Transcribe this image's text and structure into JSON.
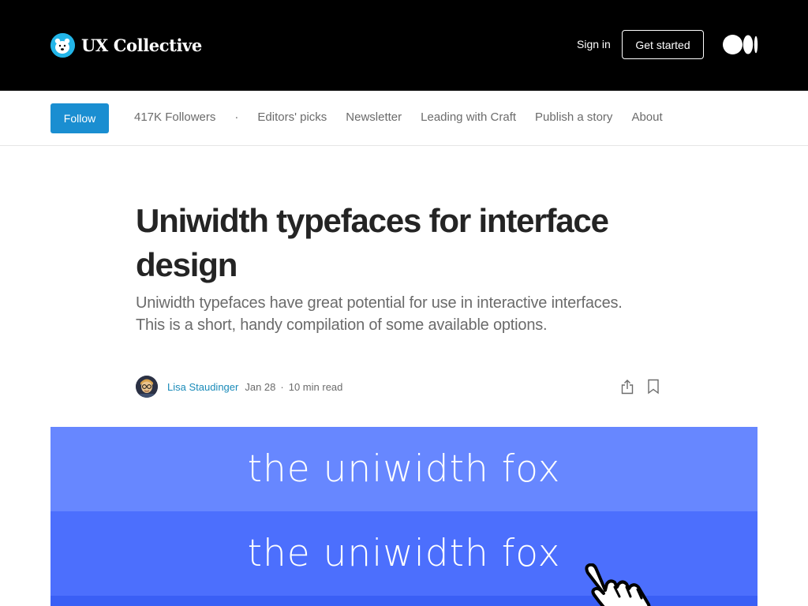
{
  "header": {
    "brand_name": "UX Collective",
    "sign_in": "Sign in",
    "get_started": "Get started",
    "medium_logo": "medium-logo-icon"
  },
  "pubnav": {
    "follow": "Follow",
    "followers": "417K Followers",
    "separator": "·",
    "links": [
      "Editors' picks",
      "Newsletter",
      "Leading with Craft",
      "Publish a story",
      "About"
    ]
  },
  "article": {
    "title": "Uniwidth typefaces for interface design",
    "subtitle": "Uniwidth typefaces have great potential for use in interactive interfaces. This is a short, handy compilation of some available options.",
    "author": "Lisa Staudinger",
    "date": "Jan 28",
    "dot": "·",
    "read_time": "10 min read",
    "icons": [
      "share-icon",
      "bookmark-icon"
    ]
  },
  "hero": {
    "line1": "the uniwidth fox",
    "line2": "the uniwidth fox"
  },
  "colors": {
    "header_bg": "#000000",
    "accent": "#1a8ed1",
    "hero_band_1": "#6787ff",
    "hero_band_2": "#4c6ffd"
  }
}
